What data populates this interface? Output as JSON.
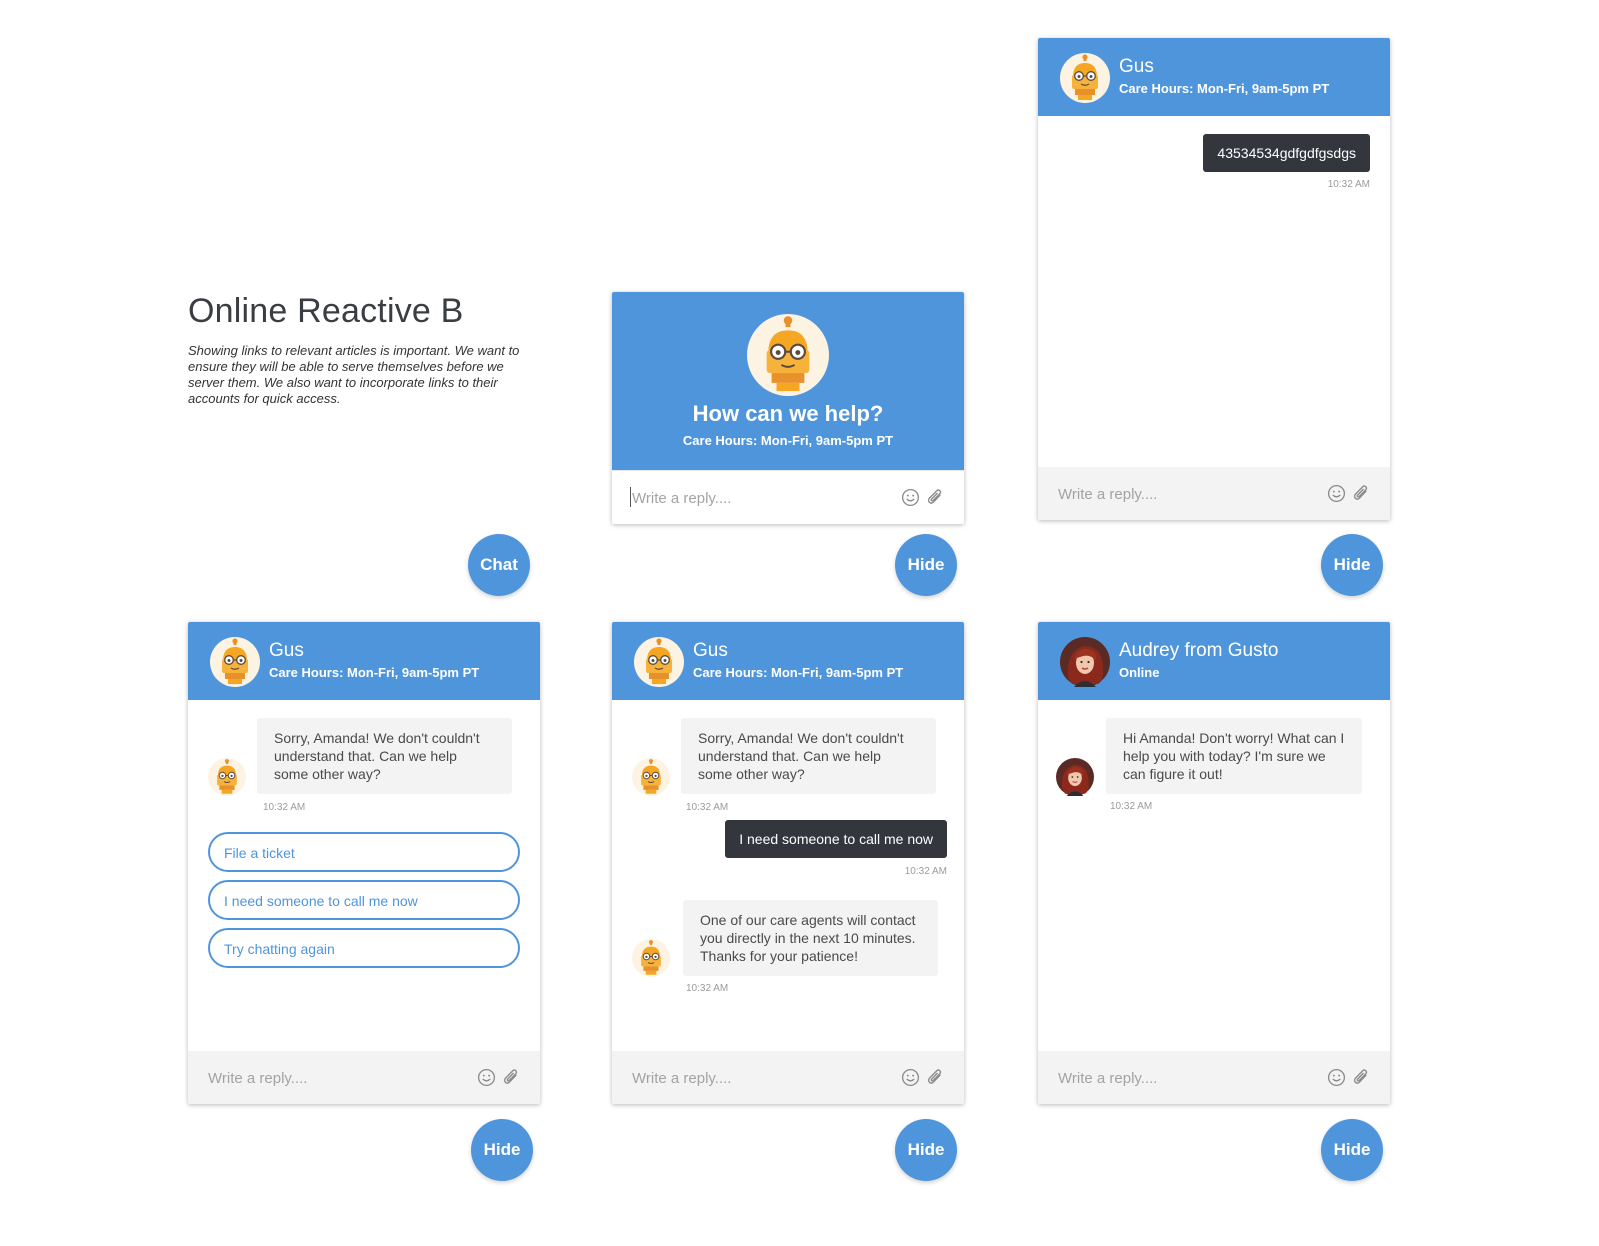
{
  "intro": {
    "title": "Online Reactive B",
    "description": "Showing links to relevant articles is important. We want to ensure they will be able to serve themselves before we server them. We also want to incorporate links to their accounts for quick access."
  },
  "colors": {
    "brand_blue": "#4f95dc",
    "dark_bubble": "#33373d",
    "light_bubble": "#f3f3f3",
    "avatar_bot": "#f5a623"
  },
  "composer": {
    "placeholder": "Write a reply...."
  },
  "icons": {
    "emoji": "smiley-icon",
    "attach": "paperclip-icon",
    "bot": "robot-avatar-icon",
    "agent": "agent-avatar"
  },
  "chat_button": {
    "label": "Chat"
  },
  "hide_button": {
    "label": "Hide"
  },
  "welcome_widget": {
    "title": "How can we help?",
    "hours": "Care Hours: Mon-Fri, 9am-5pm PT"
  },
  "bot_header": {
    "name": "Gus",
    "hours": "Care Hours: Mon-Fri, 9am-5pm PT"
  },
  "widget_user_message": {
    "message": "43534534gdfgdfgsdgs",
    "time": "10:32 AM"
  },
  "widget_options": {
    "message": "Sorry, Amanda! We don't couldn't understand that. Can we help some other way?",
    "time": "10:32 AM",
    "options": [
      "File a ticket",
      "I need someone to call me now",
      "Try chatting again"
    ]
  },
  "widget_callback": {
    "message1": "Sorry, Amanda! We don't couldn't understand that. Can we help some other way?",
    "time1": "10:32 AM",
    "reply": "I need someone to call me now",
    "time2": "10:32 AM",
    "message2": "One of our care agents will contact you directly in the next 10 minutes. Thanks for your patience!",
    "time3": "10:32 AM"
  },
  "widget_agent": {
    "name": "Audrey from Gusto",
    "status": "Online",
    "message": "Hi Amanda! Don't worry! What can I help you with today? I'm sure we can figure it out!",
    "time": "10:32 AM"
  }
}
